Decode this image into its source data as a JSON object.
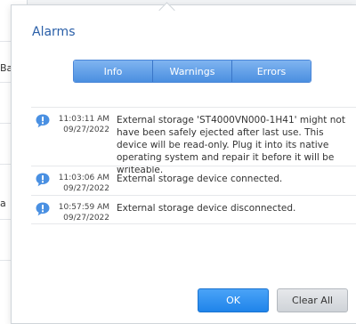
{
  "background": {
    "fragments": [
      "Ba",
      "a"
    ]
  },
  "popover": {
    "title": "Alarms",
    "tabs": [
      {
        "label": "Info"
      },
      {
        "label": "Warnings"
      },
      {
        "label": "Errors"
      }
    ],
    "alarms": [
      {
        "time": "11:03:11 AM",
        "date": "09/27/2022",
        "message": "External storage 'ST4000VN000-1H41' might not have been safely ejected after last use. This device will be read-only. Plug it into its native operating system and repair it before it will be writeable.",
        "icon": "info-icon"
      },
      {
        "time": "11:03:06 AM",
        "date": "09/27/2022",
        "message": "External storage device connected.",
        "icon": "info-icon"
      },
      {
        "time": "10:57:59 AM",
        "date": "09/27/2022",
        "message": "External storage device disconnected.",
        "icon": "info-icon"
      }
    ],
    "buttons": {
      "ok": "OK",
      "clear_all": "Clear All"
    }
  },
  "colors": {
    "accent": "#4b8fe0",
    "title": "#2a5fa8",
    "info_icon": "#4a90e2"
  }
}
